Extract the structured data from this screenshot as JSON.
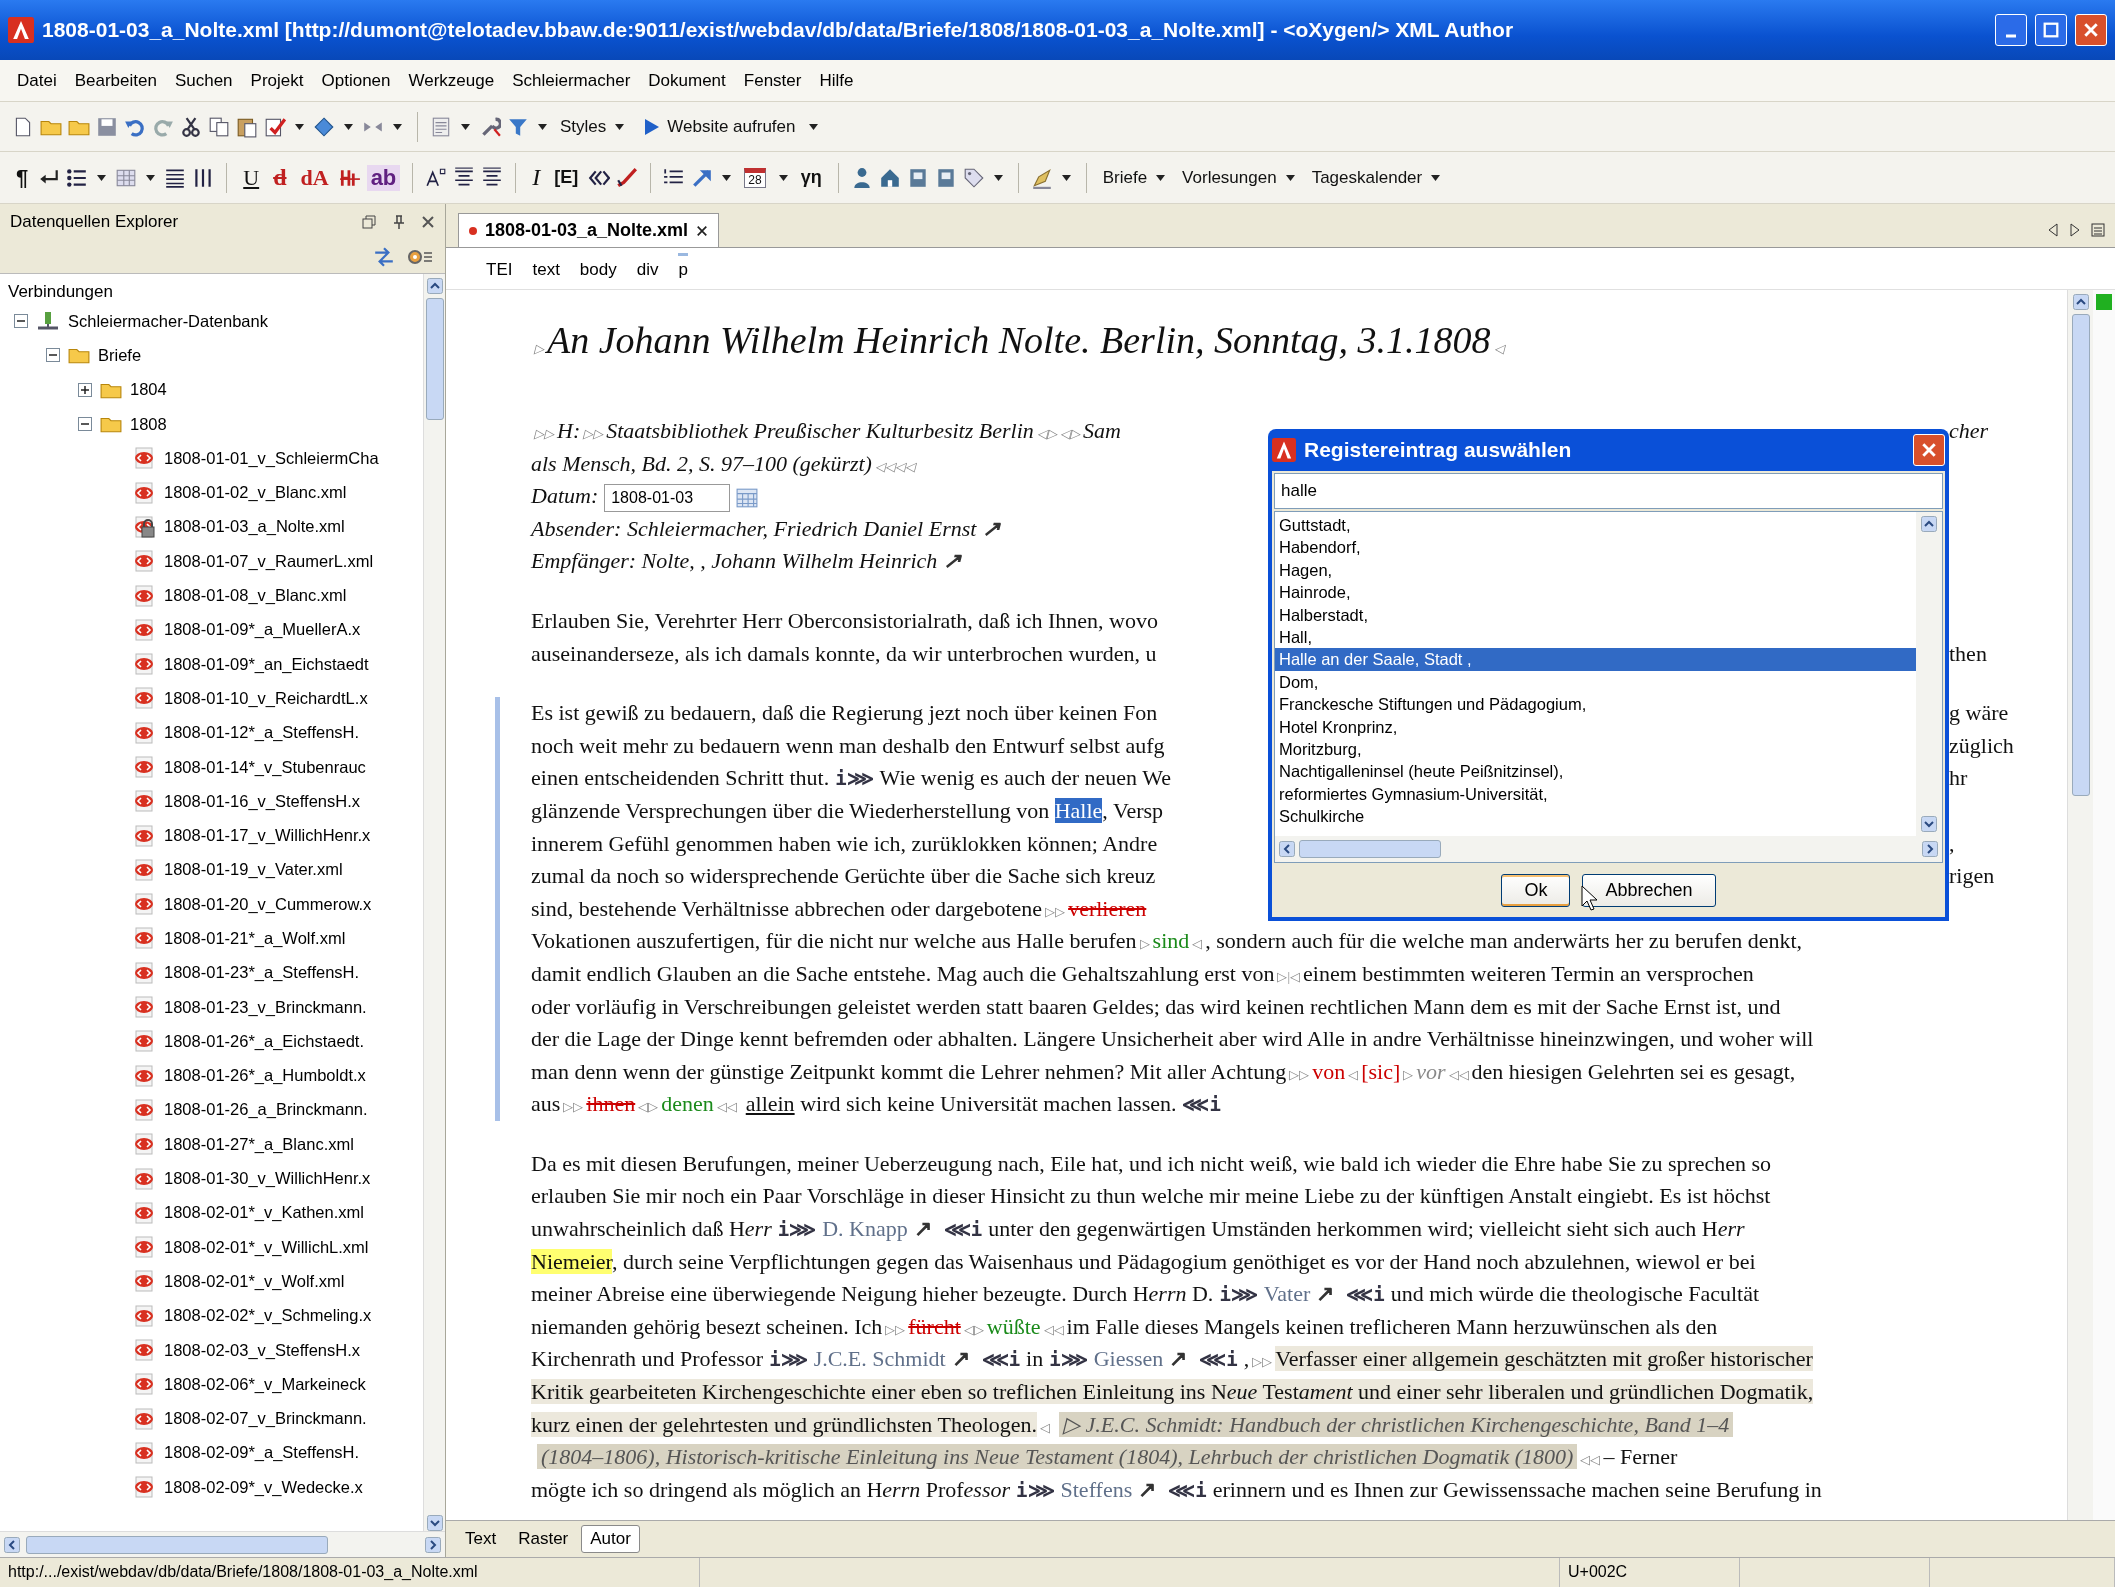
{
  "window": {
    "title": "1808-01-03_a_Nolte.xml [http://dumont@telotadev.bbaw.de:9011/exist/webdav/db/data/Briefe/1808/1808-01-03_a_Nolte.xml] - <oXygen/> XML Author"
  },
  "menu": [
    "Datei",
    "Bearbeiten",
    "Suchen",
    "Projekt",
    "Optionen",
    "Werkzeuge",
    "Schleiermacher",
    "Dokument",
    "Fenster",
    "Hilfe"
  ],
  "toolbar_1": [
    {
      "kind": "icon"
    },
    {
      "kind": "icon"
    },
    {
      "kind": "icon"
    },
    {
      "kind": "icon"
    },
    {
      "kind": "icon"
    },
    {
      "kind": "icon"
    },
    {
      "kind": "icon"
    },
    {
      "kind": "icon"
    },
    {
      "kind": "icon"
    },
    {
      "kind": "icon"
    },
    {
      "kind": "caret"
    },
    {
      "kind": "icon"
    },
    {
      "kind": "caret"
    },
    {
      "kind": "icon"
    },
    {
      "kind": "caret"
    },
    {
      "kind": "separator"
    },
    {
      "kind": "icon"
    },
    {
      "kind": "caret"
    },
    {
      "kind": "icon"
    },
    {
      "kind": "icon"
    },
    {
      "kind": "caret"
    },
    {
      "kind": "menu",
      "label": "Styles"
    },
    {
      "kind": "action",
      "label": "Website aufrufen"
    },
    {
      "kind": "caret"
    }
  ],
  "toolbar_2": [
    {
      "kind": "glyph",
      "label": "¶"
    },
    {
      "kind": "icon"
    },
    {
      "kind": "icon"
    },
    {
      "kind": "caret"
    },
    {
      "kind": "icon"
    },
    {
      "kind": "caret"
    },
    {
      "kind": "icon"
    },
    {
      "kind": "icon"
    },
    {
      "kind": "separator"
    },
    {
      "kind": "glyph",
      "label": "U"
    },
    {
      "kind": "glyph",
      "label": "d"
    },
    {
      "kind": "glyph",
      "label": "dA"
    },
    {
      "kind": "icon"
    },
    {
      "kind": "glyph",
      "label": "ab"
    },
    {
      "kind": "separator"
    },
    {
      "kind": "icon"
    },
    {
      "kind": "icon"
    },
    {
      "kind": "icon"
    },
    {
      "kind": "separator"
    },
    {
      "kind": "glyph",
      "label": "I"
    },
    {
      "kind": "glyph",
      "label": "[E]"
    },
    {
      "kind": "icon"
    },
    {
      "kind": "icon"
    },
    {
      "kind": "separator"
    },
    {
      "kind": "icon"
    },
    {
      "kind": "icon"
    },
    {
      "kind": "caret"
    },
    {
      "kind": "calendar",
      "label": "28"
    },
    {
      "kind": "caret"
    },
    {
      "kind": "glyph",
      "label": "γη"
    },
    {
      "kind": "separator"
    },
    {
      "kind": "icon"
    },
    {
      "kind": "icon"
    },
    {
      "kind": "icon"
    },
    {
      "kind": "icon"
    },
    {
      "kind": "icon"
    },
    {
      "kind": "caret"
    },
    {
      "kind": "separator"
    },
    {
      "kind": "icon"
    },
    {
      "kind": "caret"
    },
    {
      "kind": "separator"
    },
    {
      "kind": "menu",
      "label": "Briefe"
    },
    {
      "kind": "menu",
      "label": "Vorlesungen"
    },
    {
      "kind": "menu",
      "label": "Tageskalender"
    }
  ],
  "sidebar": {
    "title": "Datenquellen Explorer",
    "section": "Verbindungen",
    "tree": [
      {
        "kind": "database",
        "label": "Schleiermacher-Datenbank",
        "expanded": true,
        "children": [
          {
            "kind": "folder",
            "label": "Briefe",
            "expanded": true,
            "children": [
              {
                "kind": "folder",
                "label": "1804",
                "expanded": false
              },
              {
                "kind": "folder",
                "label": "1808",
                "expanded": true,
                "children": [
                  {
                    "kind": "file",
                    "label": "1808-01-01_v_SchleiermCha",
                    "locked": false
                  },
                  {
                    "kind": "file",
                    "label": "1808-01-02_v_Blanc.xml",
                    "locked": false
                  },
                  {
                    "kind": "file",
                    "label": "1808-01-03_a_Nolte.xml",
                    "locked": true
                  },
                  {
                    "kind": "file",
                    "label": "1808-01-07_v_RaumerL.xml",
                    "locked": false
                  },
                  {
                    "kind": "file",
                    "label": "1808-01-08_v_Blanc.xml",
                    "locked": false
                  },
                  {
                    "kind": "file",
                    "label": "1808-01-09*_a_MuellerA.x",
                    "locked": false
                  },
                  {
                    "kind": "file",
                    "label": "1808-01-09*_an_Eichstaedt",
                    "locked": false
                  },
                  {
                    "kind": "file",
                    "label": "1808-01-10_v_ReichardtL.x",
                    "locked": false
                  },
                  {
                    "kind": "file",
                    "label": "1808-01-12*_a_SteffensH.",
                    "locked": false
                  },
                  {
                    "kind": "file",
                    "label": "1808-01-14*_v_Stubenrauc",
                    "locked": false
                  },
                  {
                    "kind": "file",
                    "label": "1808-01-16_v_SteffensH.x",
                    "locked": false
                  },
                  {
                    "kind": "file",
                    "label": "1808-01-17_v_WillichHenr.x",
                    "locked": false
                  },
                  {
                    "kind": "file",
                    "label": "1808-01-19_v_Vater.xml",
                    "locked": false
                  },
                  {
                    "kind": "file",
                    "label": "1808-01-20_v_Cummerow.x",
                    "locked": false
                  },
                  {
                    "kind": "file",
                    "label": "1808-01-21*_a_Wolf.xml",
                    "locked": false
                  },
                  {
                    "kind": "file",
                    "label": "1808-01-23*_a_SteffensH.",
                    "locked": false
                  },
                  {
                    "kind": "file",
                    "label": "1808-01-23_v_Brinckmann.",
                    "locked": false
                  },
                  {
                    "kind": "file",
                    "label": "1808-01-26*_a_Eichstaedt.",
                    "locked": false
                  },
                  {
                    "kind": "file",
                    "label": "1808-01-26*_a_Humboldt.x",
                    "locked": false
                  },
                  {
                    "kind": "file",
                    "label": "1808-01-26_a_Brinckmann.",
                    "locked": false
                  },
                  {
                    "kind": "file",
                    "label": "1808-01-27*_a_Blanc.xml",
                    "locked": false
                  },
                  {
                    "kind": "file",
                    "label": "1808-01-30_v_WillichHenr.x",
                    "locked": false
                  },
                  {
                    "kind": "file",
                    "label": "1808-02-01*_v_Kathen.xml",
                    "locked": false
                  },
                  {
                    "kind": "file",
                    "label": "1808-02-01*_v_WillichL.xml",
                    "locked": false
                  },
                  {
                    "kind": "file",
                    "label": "1808-02-01*_v_Wolf.xml",
                    "locked": false
                  },
                  {
                    "kind": "file",
                    "label": "1808-02-02*_v_Schmeling.x",
                    "locked": false
                  },
                  {
                    "kind": "file",
                    "label": "1808-02-03_v_SteffensH.x",
                    "locked": false
                  },
                  {
                    "kind": "file",
                    "label": "1808-02-06*_v_Markeineck",
                    "locked": false
                  },
                  {
                    "kind": "file",
                    "label": "1808-02-07_v_Brinckmann.",
                    "locked": false
                  },
                  {
                    "kind": "file",
                    "label": "1808-02-09*_a_SteffensH.",
                    "locked": false
                  },
                  {
                    "kind": "file",
                    "label": "1808-02-09*_v_Wedecke.x",
                    "locked": false
                  }
                ]
              }
            ]
          }
        ]
      }
    ]
  },
  "editor": {
    "tabs": [
      {
        "label": "1808-01-03_a_Nolte.xml",
        "modified": true,
        "selected": true
      }
    ],
    "breadcrumb": [
      {
        "label": "TEI",
        "selected": false
      },
      {
        "label": "text",
        "selected": false
      },
      {
        "label": "body",
        "selected": false
      },
      {
        "label": "div",
        "selected": false
      },
      {
        "label": "p",
        "selected": true
      }
    ],
    "document": {
      "heading": [
        {
          "kind": "mark",
          "text": "▷"
        },
        {
          "kind": "plain",
          "text": "An Johann Wilhelm Heinrich Nolte. Berlin, Sonntag, 3.1.1808"
        },
        {
          "kind": "mark",
          "text": "◁"
        }
      ],
      "meta": [
        {
          "left": [
            {
              "kind": "mark",
              "text": "▷▷"
            },
            {
              "kind": "plain",
              "text": "H:"
            },
            {
              "kind": "mark",
              "text": "▷▷"
            },
            {
              "kind": "plain",
              "text": "Staatsbibliothek Preußischer Kulturbesitz Berlin"
            },
            {
              "kind": "mark",
              "text": "◁▷ ◁▷"
            },
            {
              "kind": "plain",
              "text": "Sam"
            }
          ],
          "right": [
            {
              "kind": "plain",
              "text": "cher"
            }
          ]
        },
        {
          "segs": [
            {
              "kind": "plain",
              "text": "als Mensch, Bd. 2, S. 97–100 (gekürzt)"
            },
            {
              "kind": "mark",
              "text": "◁◁◁◁"
            }
          ]
        },
        {
          "segs": [
            {
              "kind": "plain",
              "text": "Datum:"
            }
          ],
          "field": "1808-01-03"
        },
        {
          "segs": [
            {
              "kind": "plain",
              "text": "Absender: Schleiermacher, Friedrich Daniel Ernst"
            },
            {
              "kind": "arrow",
              "text": "↗"
            }
          ]
        },
        {
          "segs": [
            {
              "kind": "plain",
              "text": "Empfänger: Nolte, , Johann Wilhelm Heinrich"
            },
            {
              "kind": "arrow",
              "text": "↗"
            }
          ]
        }
      ],
      "paragraphs": [
        {
          "change_bar": false,
          "lines": [
            {
              "left": [
                {
                  "kind": "plain",
                  "text": "Erlauben Sie, Verehrter Herr Oberconsistorialrath, daß ich Ihnen, wovo"
                }
              ]
            },
            {
              "left": [
                {
                  "kind": "plain",
                  "text": "auseinanderseze, als ich damals konnte, da wir unterbrochen wurden, u"
                }
              ],
              "right": [
                {
                  "kind": "plain",
                  "text": "then"
                }
              ]
            }
          ]
        },
        {
          "change_bar": true,
          "lines": [
            {
              "left": [
                {
                  "kind": "plain",
                  "text": "Es ist gewiß zu bedauern, daß die Regierung jezt noch über keinen Fon"
                }
              ],
              "right": [
                {
                  "kind": "plain",
                  "text": "g wäre"
                }
              ]
            },
            {
              "left": [
                {
                  "kind": "plain",
                  "text": "noch weit mehr zu bedauern wenn man deshalb den Entwurf selbst aufg"
                }
              ],
              "right": [
                {
                  "kind": "plain",
                  "text": "züglich"
                }
              ]
            },
            {
              "left": [
                {
                  "kind": "plain",
                  "text": "einen entscheidenden Schritt thut."
                },
                {
                  "kind": "tag",
                  "text": "i⋙"
                },
                {
                  "kind": "plain",
                  "text": "Wie wenig es auch der neuen We"
                }
              ],
              "right": [
                {
                  "kind": "plain",
                  "text": "hr"
                }
              ]
            },
            {
              "left": [
                {
                  "kind": "plain",
                  "text": "glänzende Versprechungen über die Wiederherstellung von "
                },
                {
                  "kind": "selected",
                  "text": "Halle"
                },
                {
                  "kind": "plain",
                  "text": ", Versp"
                }
              ]
            },
            {
              "left": [
                {
                  "kind": "plain",
                  "text": "innerem Gefühl genommen haben wie ich, zurüklokken können; Andre"
                }
              ],
              "right": [
                {
                  "kind": "plain",
                  "text": ","
                }
              ]
            },
            {
              "left": [
                {
                  "kind": "plain",
                  "text": "zumal da noch so widersprechende Gerüchte über die Sache sich kreuz"
                }
              ],
              "right": [
                {
                  "kind": "plain",
                  "text": "rigen"
                }
              ]
            },
            {
              "left": [
                {
                  "kind": "plain",
                  "text": "sind, bestehende Verhältnisse abbrechen oder dargebotene"
                },
                {
                  "kind": "mark",
                  "text": "▷▷"
                },
                {
                  "kind": "deleted",
                  "text": "verlieren"
                }
              ]
            },
            {
              "segs": [
                {
                  "kind": "plain",
                  "text": "Vokationen auszufertigen, für die nicht nur welche aus Halle berufen"
                },
                {
                  "kind": "mark",
                  "text": "▷"
                },
                {
                  "kind": "added",
                  "text": "sind"
                },
                {
                  "kind": "mark",
                  "text": "◁"
                },
                {
                  "kind": "plain",
                  "text": ", sondern auch für die welche man anderwärts her zu berufen denkt,"
                }
              ]
            },
            {
              "segs": [
                {
                  "kind": "plain",
                  "text": "damit endlich Glauben an die Sache entstehe. Mag auch die Gehaltszahlung erst von"
                },
                {
                  "kind": "mark",
                  "text": "▷|◁"
                },
                {
                  "kind": "plain",
                  "text": "einem bestimmten weiteren Termin an versprochen"
                }
              ]
            },
            {
              "segs": [
                {
                  "kind": "plain",
                  "text": "oder vorläufig in Verschreibungen geleistet werden statt baaren Geldes; das wird keinen rechtlichen Mann dem es mit der Sache Ernst ist, und"
                }
              ]
            },
            {
              "segs": [
                {
                  "kind": "plain",
                  "text": "der die Lage der Dinge kennt befremden oder abhalten. Längere Unsicherheit aber wird Alle in andre Verhältnisse hineinzwingen, und woher will"
                }
              ]
            },
            {
              "segs": [
                {
                  "kind": "plain",
                  "text": "man denn wenn der günstige Zeitpunkt kommt die Lehrer nehmen? Mit aller Achtung"
                },
                {
                  "kind": "mark",
                  "text": "▷▷"
                },
                {
                  "kind": "sic",
                  "text": "von"
                },
                {
                  "kind": "mark",
                  "text": "◁"
                },
                {
                  "kind": "sic",
                  "text": "[sic]"
                },
                {
                  "kind": "mark",
                  "text": "▷"
                },
                {
                  "kind": "correction",
                  "text": "vor"
                },
                {
                  "kind": "mark",
                  "text": "◁◁"
                },
                {
                  "kind": "plain",
                  "text": "den hiesigen Gelehrten sei es gesagt,"
                }
              ]
            },
            {
              "segs": [
                {
                  "kind": "plain",
                  "text": "aus"
                },
                {
                  "kind": "mark",
                  "text": "▷▷"
                },
                {
                  "kind": "deleted",
                  "text": "ihnen"
                },
                {
                  "kind": "mark",
                  "text": "◁▷"
                },
                {
                  "kind": "added",
                  "text": "denen"
                },
                {
                  "kind": "mark",
                  "text": "◁◁"
                },
                {
                  "kind": "underlined",
                  "text": "allein"
                },
                {
                  "kind": "plain",
                  "text": " wird sich keine Universität machen lassen."
                },
                {
                  "kind": "tag",
                  "text": "⋘i"
                }
              ]
            }
          ]
        },
        {
          "change_bar": false,
          "lines": [
            {
              "segs": [
                {
                  "kind": "plain",
                  "text": "Da es mit diesen Berufungen, meiner Ueberzeugung nach, Eile hat, und ich nicht weiß, wie bald ich wieder die Ehre habe Sie zu sprechen so"
                }
              ]
            },
            {
              "segs": [
                {
                  "kind": "plain",
                  "text": "erlauben Sie mir noch ein Paar Vorschläge in dieser Hinsicht zu thun welche mir meine Liebe zu der künftigen Anstalt eingiebt. Es ist höchst"
                }
              ]
            },
            {
              "segs": [
                {
                  "kind": "plain",
                  "text": "unwahrscheinlich daß H"
                },
                {
                  "kind": "italic",
                  "text": "err"
                },
                {
                  "kind": "tag",
                  "text": "i⋙"
                },
                {
                  "kind": "link",
                  "text": "D. Knapp"
                },
                {
                  "kind": "arrow",
                  "text": "↗"
                },
                {
                  "kind": "tag",
                  "text": "⋘i"
                },
                {
                  "kind": "plain",
                  "text": "unter den gegenwärtigen Umständen herkommen wird; vielleicht sieht sich auch H"
                },
                {
                  "kind": "italic",
                  "text": "err"
                }
              ]
            },
            {
              "segs": [
                {
                  "kind": "highlight",
                  "text": "Niemeier"
                },
                {
                  "kind": "plain",
                  "text": ", durch seine Verpflichtungen gegen das Waisenhaus und Pädagogium genöthiget es vor der Hand noch abzulehnen, wiewol er bei"
                }
              ]
            },
            {
              "segs": [
                {
                  "kind": "plain",
                  "text": "meiner Abreise eine überwiegende Neigung hieher bezeugte. Durch H"
                },
                {
                  "kind": "italic",
                  "text": "errn"
                },
                {
                  "kind": "plain",
                  "text": " D."
                },
                {
                  "kind": "tag",
                  "text": "i⋙"
                },
                {
                  "kind": "link",
                  "text": "Vater"
                },
                {
                  "kind": "arrow",
                  "text": "↗"
                },
                {
                  "kind": "tag",
                  "text": "⋘i"
                },
                {
                  "kind": "plain",
                  "text": "und mich würde die theologische Facultät"
                }
              ]
            },
            {
              "segs": [
                {
                  "kind": "plain",
                  "text": "niemanden gehörig besezt scheinen. Ich"
                },
                {
                  "kind": "mark",
                  "text": "▷▷"
                },
                {
                  "kind": "deleted",
                  "text": "fürcht"
                },
                {
                  "kind": "mark",
                  "text": "◁▷"
                },
                {
                  "kind": "added",
                  "text": "wüßte"
                },
                {
                  "kind": "mark",
                  "text": "◁◁"
                },
                {
                  "kind": "plain",
                  "text": "im Falle dieses Mangels keinen treflicheren Mann herzuwünschen als den"
                }
              ]
            },
            {
              "segs": [
                {
                  "kind": "plain",
                  "text": "Kirchenrath und Professor"
                },
                {
                  "kind": "tag",
                  "text": "i⋙"
                },
                {
                  "kind": "link",
                  "text": "J.C.E. Schmidt"
                },
                {
                  "kind": "arrow",
                  "text": "↗"
                },
                {
                  "kind": "tag",
                  "text": "⋘i"
                },
                {
                  "kind": "plain",
                  "text": "in"
                },
                {
                  "kind": "tag",
                  "text": "i⋙"
                },
                {
                  "kind": "link",
                  "text": "Giessen"
                },
                {
                  "kind": "arrow",
                  "text": "↗"
                },
                {
                  "kind": "tag",
                  "text": "⋘i"
                },
                {
                  "kind": "plain",
                  "text": ","
                },
                {
                  "kind": "mark",
                  "text": "▷▷"
                },
                {
                  "kind": "shaded",
                  "text": "Verfasser einer allgemein geschätzten mit großer historischer"
                }
              ]
            },
            {
              "segs": [
                {
                  "kind": "shaded",
                  "text": "Kritik gearbeiteten Kirchengeschichte einer eben so treflichen Einleitung ins N"
                },
                {
                  "kind": "shaded-italic",
                  "text": "eue"
                },
                {
                  "kind": "shaded",
                  "text": " Test"
                },
                {
                  "kind": "shaded-italic",
                  "text": "ament"
                },
                {
                  "kind": "shaded",
                  "text": " und einer sehr liberalen und gründlichen Dogmatik,"
                }
              ]
            },
            {
              "segs": [
                {
                  "kind": "shaded",
                  "text": "kurz einen der gelehrtesten und gründlichsten Theologen."
                },
                {
                  "kind": "mark",
                  "text": "◁"
                },
                {
                  "kind": "note",
                  "text": "▷ J.E.C. Schmidt: Handbuch der christlichen Kirchengeschichte, Band 1–4"
                }
              ]
            },
            {
              "segs": [
                {
                  "kind": "note",
                  "text": "(1804–1806), Historisch-kritische Einleitung ins Neue Testament (1804), Lehrbuch der christlichen Dogmatik (1800)"
                },
                {
                  "kind": "mark",
                  "text": "◁◁"
                },
                {
                  "kind": "plain",
                  "text": "– Ferner"
                }
              ]
            },
            {
              "segs": [
                {
                  "kind": "plain",
                  "text": "mögte ich so dringend als möglich an H"
                },
                {
                  "kind": "italic",
                  "text": "errn"
                },
                {
                  "kind": "plain",
                  "text": " Prof"
                },
                {
                  "kind": "italic",
                  "text": "essor"
                },
                {
                  "kind": "tag",
                  "text": "i⋙"
                },
                {
                  "kind": "link",
                  "text": "Steffens"
                },
                {
                  "kind": "arrow",
                  "text": "↗"
                },
                {
                  "kind": "tag",
                  "text": "⋘i"
                },
                {
                  "kind": "plain",
                  "text": "erinnern und es Ihnen zur Gewissenssache machen seine Berufung in"
                }
              ]
            }
          ]
        }
      ]
    },
    "mode_tabs": [
      {
        "label": "Text",
        "selected": false
      },
      {
        "label": "Raster",
        "selected": false
      },
      {
        "label": "Autor",
        "selected": true
      }
    ]
  },
  "dialog": {
    "title": "Registereintrag auswählen",
    "search": {
      "value": "halle"
    },
    "items": [
      {
        "label": "Guttstadt,",
        "selected": false
      },
      {
        "label": "Habendorf,",
        "selected": false
      },
      {
        "label": "Hagen,",
        "selected": false
      },
      {
        "label": "Hainrode,",
        "selected": false
      },
      {
        "label": "Halberstadt,",
        "selected": false
      },
      {
        "label": "Hall,",
        "selected": false
      },
      {
        "label": "Halle an der Saale, Stadt ,",
        "selected": true
      },
      {
        "label": "Dom,",
        "selected": false
      },
      {
        "label": "Franckesche Stiftungen und Pädagogium,",
        "selected": false
      },
      {
        "label": "Hotel Kronprinz,",
        "selected": false
      },
      {
        "label": "Moritzburg,",
        "selected": false
      },
      {
        "label": "Nachtigalleninsel (heute Peißnitzinsel),",
        "selected": false
      },
      {
        "label": "reformiertes Gymnasium-Universität,",
        "selected": false
      },
      {
        "label": "Schulkirche",
        "selected": false
      }
    ],
    "buttons": [
      {
        "label": "Ok",
        "default": true
      },
      {
        "label": "Abbrechen",
        "default": false
      }
    ]
  },
  "status_bar": {
    "path": "http:/.../exist/webdav/db/data/Briefe/1808/1808-01-03_a_Nolte.xml",
    "character": "U+002C"
  }
}
